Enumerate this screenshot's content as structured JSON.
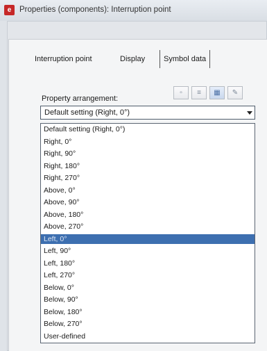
{
  "window": {
    "title": "Properties (components): Interruption point",
    "icon": "app-icon"
  },
  "tabs": [
    {
      "label": "Interruption point",
      "active": false
    },
    {
      "label": "Display",
      "active": true
    },
    {
      "label": "Symbol data",
      "active": false
    }
  ],
  "property_arrangement": {
    "label": "Property arrangement:",
    "selected_value": "Default setting (Right, 0°)",
    "toolbar": [
      {
        "icon": "save-icon",
        "active": false
      },
      {
        "icon": "list-icon",
        "active": false
      },
      {
        "icon": "grid-icon",
        "active": true
      },
      {
        "icon": "edit-icon",
        "active": false
      }
    ]
  },
  "dropdown": {
    "highlighted_index": 9,
    "highlight_color": "#3d6fb0",
    "options": [
      "Default setting (Right, 0°)",
      "Right, 0°",
      "Right, 90°",
      "Right, 180°",
      "Right, 270°",
      "Above, 0°",
      "Above, 90°",
      "Above, 180°",
      "Above, 270°",
      "Left, 0°",
      "Left, 90°",
      "Left, 180°",
      "Left, 270°",
      "Below, 0°",
      "Below, 90°",
      "Below, 180°",
      "Below, 270°",
      "User-defined"
    ]
  }
}
